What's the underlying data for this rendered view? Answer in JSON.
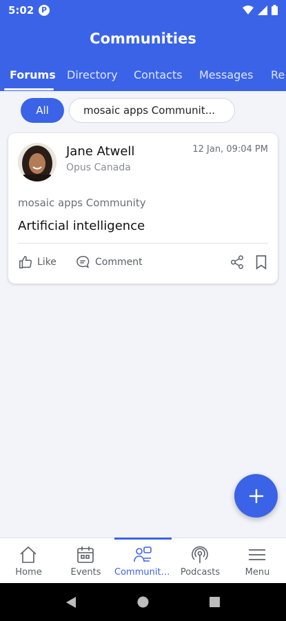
{
  "status": {
    "time": "5:02",
    "app_badge": "P"
  },
  "header": {
    "title": "Communities"
  },
  "tabs": [
    {
      "label": "Forums"
    },
    {
      "label": "Directory"
    },
    {
      "label": "Contacts"
    },
    {
      "label": "Messages"
    },
    {
      "label": "Re"
    }
  ],
  "filters": {
    "all": "All",
    "community": "mosaic apps Communit..."
  },
  "post": {
    "author": "Jane Atwell",
    "org": "Opus Canada",
    "timestamp": "12 Jan, 09:04 PM",
    "community": "mosaic apps Community",
    "title": "Artificial intelligence",
    "like_label": "Like",
    "comment_label": "Comment"
  },
  "bottom_nav": [
    {
      "label": "Home",
      "icon": "home-icon"
    },
    {
      "label": "Events",
      "icon": "calendar-icon"
    },
    {
      "label": "Communiti...",
      "icon": "communities-icon"
    },
    {
      "label": "Podcasts",
      "icon": "podcast-icon"
    },
    {
      "label": "Menu",
      "icon": "menu-icon"
    }
  ],
  "colors": {
    "accent": "#3a63e8",
    "background": "#f3f4f9"
  }
}
